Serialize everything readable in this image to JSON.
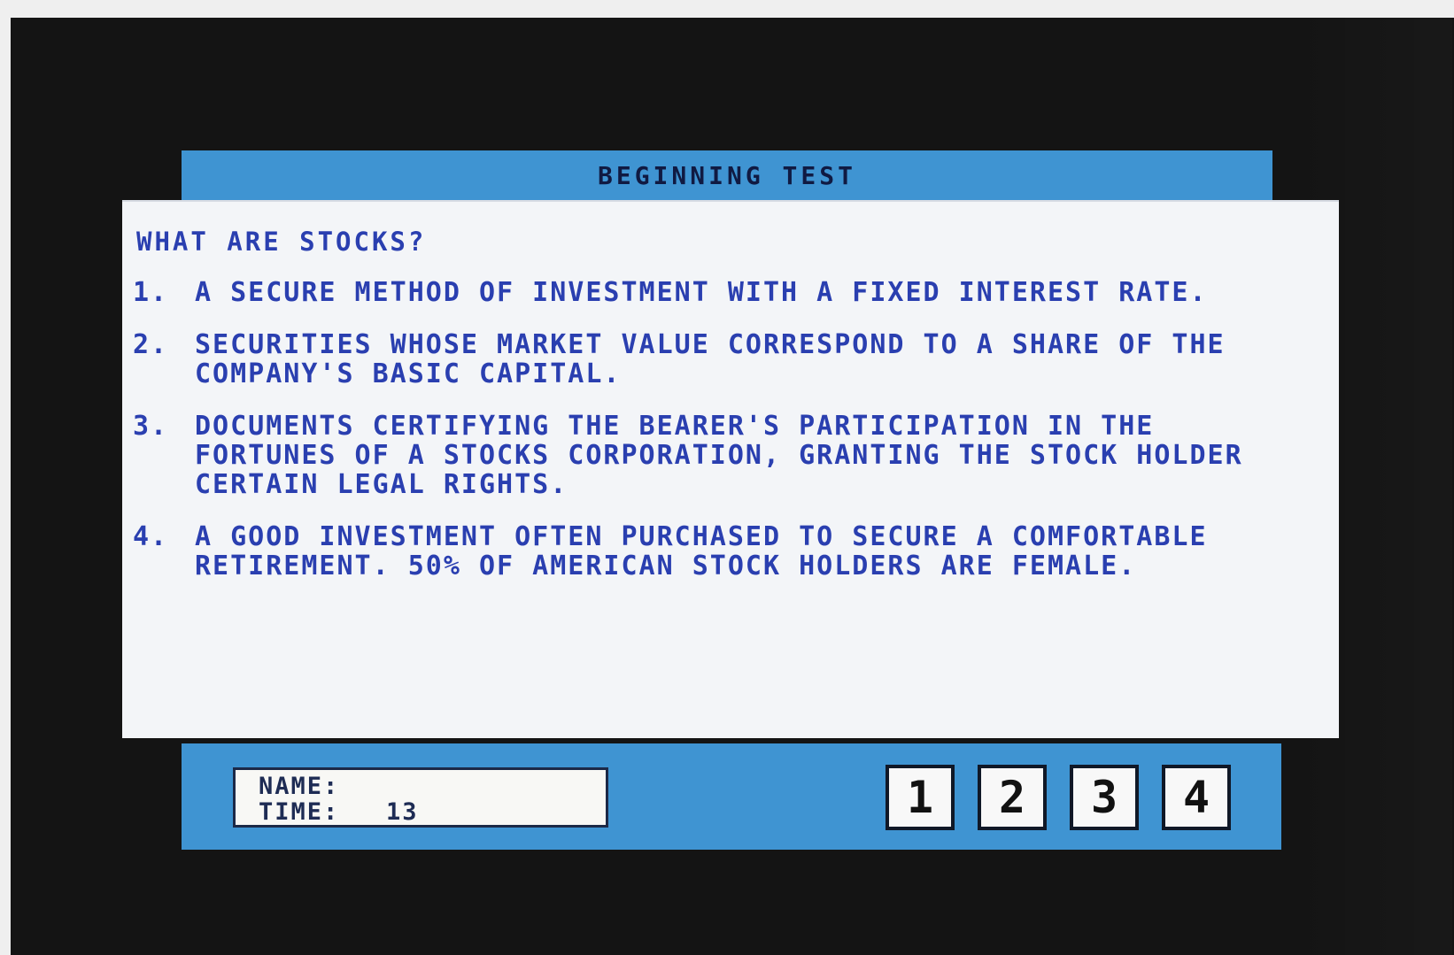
{
  "header": {
    "title": "BEGINNING TEST"
  },
  "question": {
    "text": "WHAT ARE STOCKS?"
  },
  "answers": [
    {
      "number": "1.",
      "text": "A SECURE METHOD OF INVESTMENT WITH A FIXED INTEREST RATE."
    },
    {
      "number": "2.",
      "text": "SECURITIES WHOSE MARKET VALUE CORRESPOND TO A SHARE OF THE COMPANY'S BASIC CAPITAL."
    },
    {
      "number": "3.",
      "text": "DOCUMENTS CERTIFYING THE BEARER'S PARTICIPATION IN THE FORTUNES OF A STOCKS CORPORATION, GRANTING THE STOCK HOLDER CERTAIN LEGAL RIGHTS."
    },
    {
      "number": "4.",
      "text": "A GOOD INVESTMENT OFTEN PURCHASED TO SECURE A COMFORTABLE RETIREMENT. 50% OF AMERICAN STOCK HOLDERS ARE FEMALE."
    }
  ],
  "status": {
    "name_label": "NAME:",
    "time_label": "TIME:",
    "time_value": "13"
  },
  "buttons": [
    "1",
    "2",
    "3",
    "4"
  ],
  "colors": {
    "header_blue": "#3f94d2",
    "text_blue": "#2a3fb0",
    "panel_white": "#f3f5f8",
    "screen_black": "#141414"
  }
}
